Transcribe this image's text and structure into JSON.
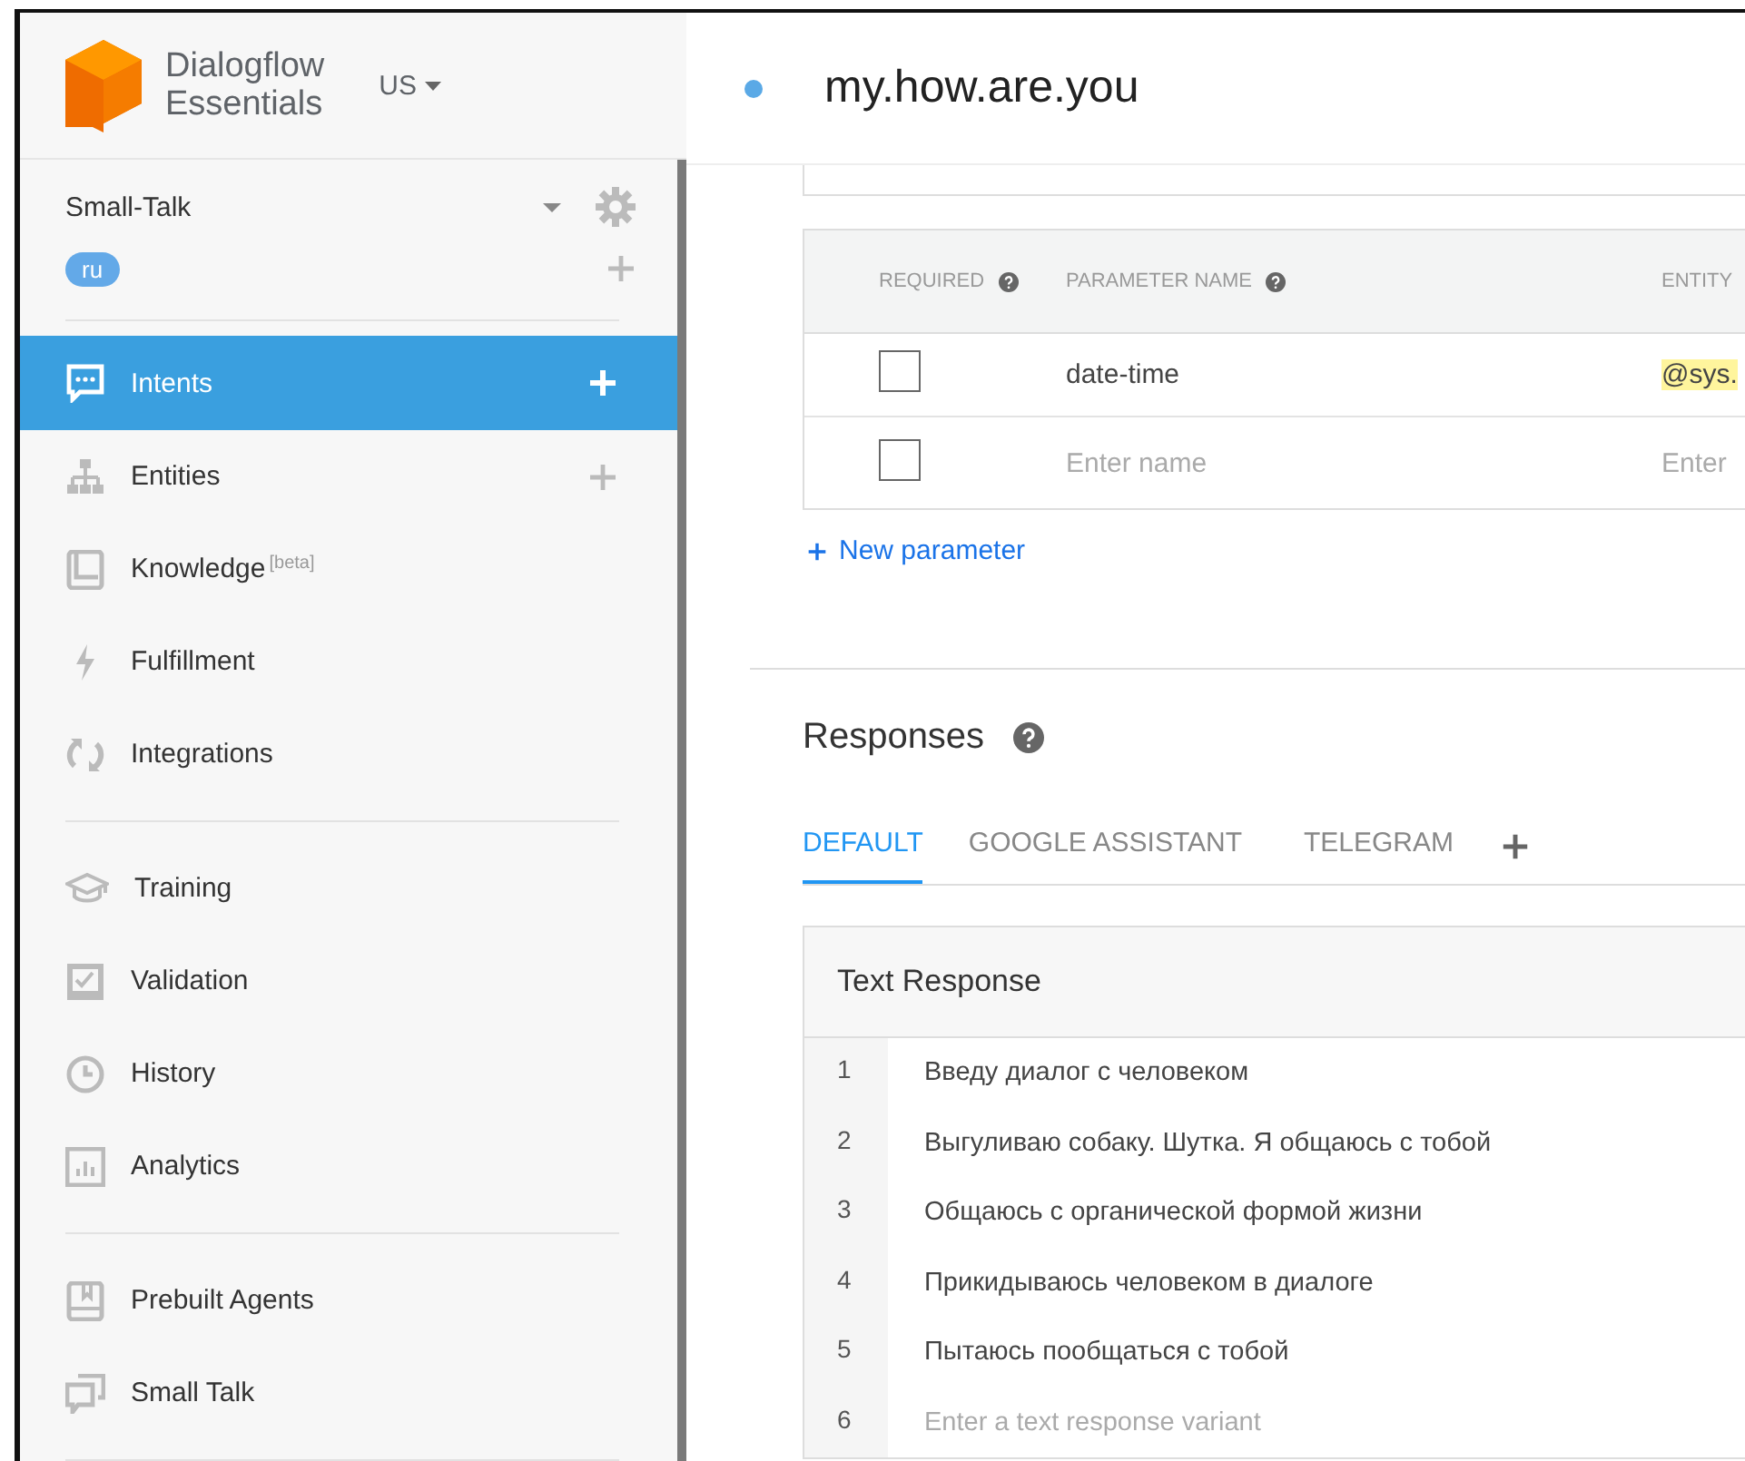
{
  "brand": {
    "line_1": "Dialogflow",
    "line_2": "Essentials",
    "region": "US"
  },
  "agent": {
    "name": "Small-Talk",
    "language": "ru"
  },
  "sidebar": {
    "sections": [
      [
        {
          "label": "Intents",
          "selected": true,
          "add": true
        },
        {
          "label": "Entities",
          "selected": false,
          "add": true
        },
        {
          "label": "Knowledge",
          "selected": false,
          "add": false,
          "badge": "[beta]"
        },
        {
          "label": "Fulfillment",
          "selected": false,
          "add": false
        },
        {
          "label": "Integrations",
          "selected": false,
          "add": false
        }
      ],
      [
        {
          "label": "Training",
          "selected": false,
          "add": false
        },
        {
          "label": "Validation",
          "selected": false,
          "add": false
        },
        {
          "label": "History",
          "selected": false,
          "add": false
        },
        {
          "label": "Analytics",
          "selected": false,
          "add": false
        }
      ],
      [
        {
          "label": "Prebuilt Agents",
          "selected": false,
          "add": false
        },
        {
          "label": "Small Talk",
          "selected": false,
          "add": false
        }
      ]
    ]
  },
  "intent": {
    "title": "my.how.are.you"
  },
  "parameters": {
    "columns": [
      "REQUIRED",
      "PARAMETER NAME",
      "ENTITY"
    ],
    "rows": [
      {
        "checked": false,
        "name": "date-time",
        "entity": "@sys."
      },
      {
        "checked": false,
        "placeholder": "Enter name",
        "entity_placeholder": "Enter"
      }
    ],
    "add_link": "New parameter"
  },
  "responses": {
    "title": "Responses",
    "tabs": [
      {
        "label": "DEFAULT",
        "selected": true
      },
      {
        "label": "GOOGLE ASSISTANT",
        "selected": false
      },
      {
        "label": "TELEGRAM",
        "selected": false
      }
    ],
    "card_title": "Text Response",
    "rows": [
      {
        "number": "1",
        "text": "Введу диалог с человеком"
      },
      {
        "number": "2",
        "text": "Выгуливаю собаку. Шутка. Я общаюсь с тобой"
      },
      {
        "number": "3",
        "text": "Общаюсь с органической формой жизни"
      },
      {
        "number": "4",
        "text": "Прикидываюсь человеком в диалоге"
      },
      {
        "number": "5",
        "text": "Пытаюсь пообщаться с тобой"
      },
      {
        "number": "6",
        "placeholder": "Enter a text response variant"
      }
    ]
  }
}
